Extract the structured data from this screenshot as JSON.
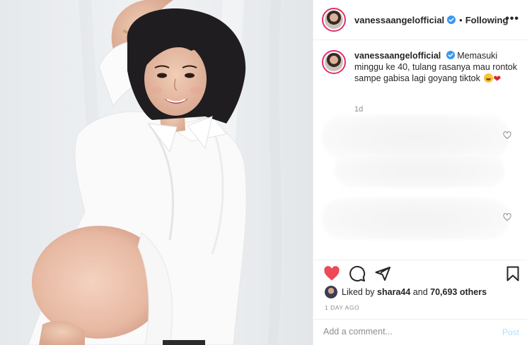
{
  "header": {
    "username": "vanessaangelofficial",
    "separator": "•",
    "follow_status": "Following",
    "more_label": "•••"
  },
  "caption": {
    "username": "vanessaangelofficial",
    "text": "Memasuki minggu ke 40, tulang rasanya mau rontok sampe gabisa lagi goyang tiktok",
    "emojis": [
      "grinning-face-emoji",
      "red-heart-emoji"
    ],
    "timestamp": "1d"
  },
  "comments": [
    {
      "state": "blurred",
      "like_icon": "heart-outline-icon"
    },
    {
      "state": "blurred",
      "like_icon": "heart-outline-icon"
    }
  ],
  "actions": {
    "like_icon": "heart-filled-icon",
    "comment_icon": "comment-icon",
    "share_icon": "paper-plane-icon",
    "save_icon": "bookmark-icon",
    "liked": true
  },
  "likes": {
    "prefix": "Liked by",
    "user": "shara44",
    "conjunction": "and",
    "count": "70,693 others"
  },
  "posted_ago": "1 DAY AGO",
  "comment_input": {
    "placeholder": "Add a comment...",
    "value": "",
    "post_label": "Post"
  },
  "colors": {
    "like_red": "#ed4956",
    "verified_blue": "#3897f0",
    "post_button_disabled": "#b2dffc",
    "story_ring": "#e1306c",
    "secondary_text": "#8e8e8e"
  }
}
